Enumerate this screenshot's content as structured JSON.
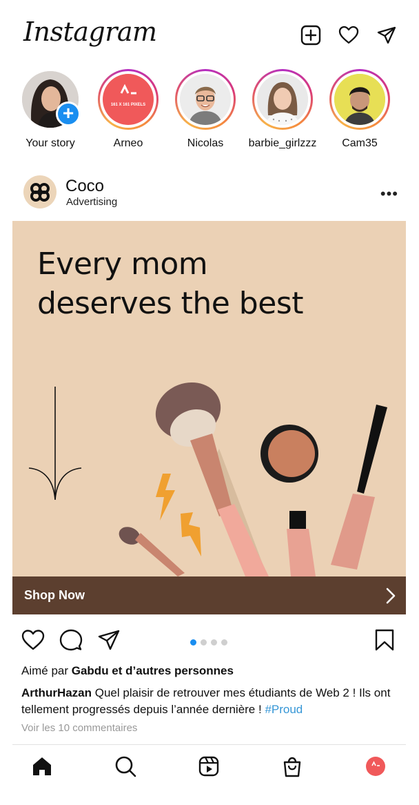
{
  "app": {
    "logo_text": "Instagram"
  },
  "header_icons": [
    "new-post-icon",
    "heart-icon",
    "direct-message-icon"
  ],
  "stories": [
    {
      "label": "Your story",
      "own": true
    },
    {
      "label": "Arneo",
      "badge": "161 X 161 PIXELS",
      "accent": "#f0595a"
    },
    {
      "label": "Nicolas"
    },
    {
      "label": "barbie_girlzzz"
    },
    {
      "label": "Cam35",
      "accent": "#e9e25a"
    }
  ],
  "post": {
    "author": "Coco",
    "subtitle": "Advertising",
    "headline_line1": "Every mom",
    "headline_line2": "deserves the best",
    "cta_label": "Shop Now",
    "carousel_count": 4,
    "carousel_active": 1,
    "likes_prefix": "Aimé par ",
    "likes_names": "Gabdu et d’autres personnes",
    "caption_user": "ArthurHazan",
    "caption_text": " Quel plaisir de retrouver mes étudiants de Web 2 ! Ils ont tellement progressés depuis l’année dernière ! ",
    "caption_hashtag": "#Proud",
    "comments_link": "Voir les 10 commentaires"
  },
  "colors": {
    "ad_background": "#ebd1b5",
    "cta_bar": "#5c3f2f",
    "accent_blue": "#1a8ef0",
    "hashtag": "#3596d6"
  },
  "bottom_nav": [
    "home-icon",
    "search-icon",
    "reels-icon",
    "shop-icon",
    "profile-avatar"
  ]
}
